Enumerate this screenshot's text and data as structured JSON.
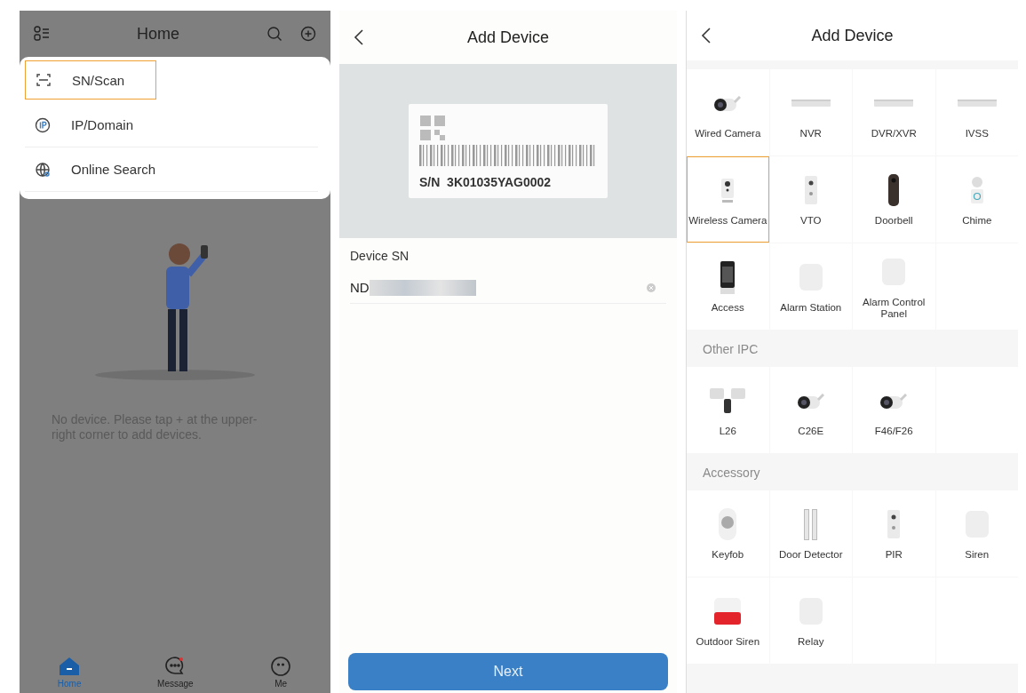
{
  "home_screen": {
    "title": "Home",
    "add_menu": [
      {
        "label": "SN/Scan",
        "kind": "scan",
        "selected": true
      },
      {
        "label": "IP/Domain",
        "kind": "ip",
        "selected": false
      },
      {
        "label": "Online Search",
        "kind": "globe",
        "selected": false
      }
    ],
    "empty_message": "No device. Please tap + at the upper-right corner to add devices.",
    "tabs": [
      {
        "label": "Home",
        "kind": "home",
        "selected": true
      },
      {
        "label": "Message",
        "kind": "message",
        "selected": false
      },
      {
        "label": "Me",
        "kind": "me",
        "selected": false
      }
    ]
  },
  "sn_screen": {
    "title": "Add Device",
    "label_serial": "S/N  3K01035YAG0002",
    "field_label": "Device SN",
    "field_value": "ND",
    "button": "Next"
  },
  "device_screen": {
    "title": "Add Device",
    "sections": [
      {
        "devices": [
          {
            "label": "Wired Camera",
            "kind": "camera",
            "selected": false
          },
          {
            "label": "NVR",
            "kind": "recorder",
            "selected": false
          },
          {
            "label": "DVR/XVR",
            "kind": "recorder",
            "selected": false
          },
          {
            "label": "IVSS",
            "kind": "recorder",
            "selected": false
          },
          {
            "label": "Wireless Camera",
            "kind": "cube",
            "selected": true
          },
          {
            "label": "VTO",
            "kind": "panel",
            "selected": false
          },
          {
            "label": "Doorbell",
            "kind": "doorbell",
            "selected": false
          },
          {
            "label": "Chime",
            "kind": "chime",
            "selected": false
          },
          {
            "label": "Access",
            "kind": "access",
            "selected": false
          },
          {
            "label": "Alarm Station",
            "kind": "hub",
            "selected": false
          },
          {
            "label": "Alarm Control Panel",
            "kind": "hub",
            "selected": false
          }
        ]
      },
      {
        "title": "Other IPC",
        "devices": [
          {
            "label": "L26",
            "kind": "floodlight",
            "selected": false
          },
          {
            "label": "C26E",
            "kind": "camera",
            "selected": false
          },
          {
            "label": "F46/F26",
            "kind": "camera",
            "selected": false
          }
        ]
      },
      {
        "title": "Accessory",
        "devices": [
          {
            "label": "Keyfob",
            "kind": "keyfob",
            "selected": false
          },
          {
            "label": "Door Detector",
            "kind": "strip",
            "selected": false
          },
          {
            "label": "PIR",
            "kind": "panel",
            "selected": false
          },
          {
            "label": "Siren",
            "kind": "hub",
            "selected": false
          },
          {
            "label": "Outdoor Siren",
            "kind": "siren",
            "selected": false
          },
          {
            "label": "Relay",
            "kind": "hub",
            "selected": false
          }
        ]
      }
    ]
  }
}
